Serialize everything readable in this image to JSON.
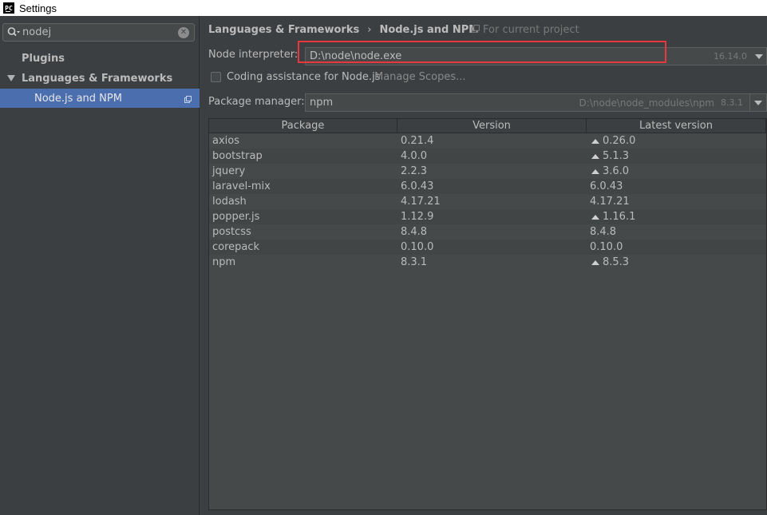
{
  "window": {
    "title": "Settings",
    "app_icon": "pycharm-icon"
  },
  "sidebar": {
    "search": {
      "value": "nodej"
    },
    "items": [
      {
        "label": "Plugins"
      },
      {
        "label": "Languages & Frameworks",
        "expanded": true
      },
      {
        "label": "Node.js and NPM",
        "selected": true
      }
    ]
  },
  "header": {
    "breadcrumb": [
      "Languages & Frameworks",
      "Node.js and NPM"
    ],
    "separator": "›",
    "project_scope": "For current project"
  },
  "interpreter": {
    "label": "Node interpreter:",
    "value": "D:\\node\\node.exe",
    "version": "16.14.0"
  },
  "coding_assistance": {
    "label": "Coding assistance for Node.js",
    "checked": false,
    "manage_link": "Manage Scopes..."
  },
  "package_manager": {
    "label": "Package manager:",
    "value": "npm",
    "path": "D:\\node\\node_modules\\npm",
    "version": "8.3.1"
  },
  "packages_table": {
    "columns": [
      "Package",
      "Version",
      "Latest version"
    ],
    "rows": [
      {
        "package": "axios",
        "version": "0.21.4",
        "latest": "0.26.0",
        "upgrade": true
      },
      {
        "package": "bootstrap",
        "version": "4.0.0",
        "latest": "5.1.3",
        "upgrade": true
      },
      {
        "package": "jquery",
        "version": "2.2.3",
        "latest": "3.6.0",
        "upgrade": true
      },
      {
        "package": "laravel-mix",
        "version": "6.0.43",
        "latest": "6.0.43",
        "upgrade": false
      },
      {
        "package": "lodash",
        "version": "4.17.21",
        "latest": "4.17.21",
        "upgrade": false
      },
      {
        "package": "popper.js",
        "version": "1.12.9",
        "latest": "1.16.1",
        "upgrade": true
      },
      {
        "package": "postcss",
        "version": "8.4.8",
        "latest": "8.4.8",
        "upgrade": false
      },
      {
        "package": "corepack",
        "version": "0.10.0",
        "latest": "0.10.0",
        "upgrade": false
      },
      {
        "package": "npm",
        "version": "8.3.1",
        "latest": "8.5.3",
        "upgrade": true
      }
    ]
  },
  "colors": {
    "background": "#3c3f41",
    "selection": "#4b6eaf",
    "highlight_annotation": "#e8373e"
  }
}
